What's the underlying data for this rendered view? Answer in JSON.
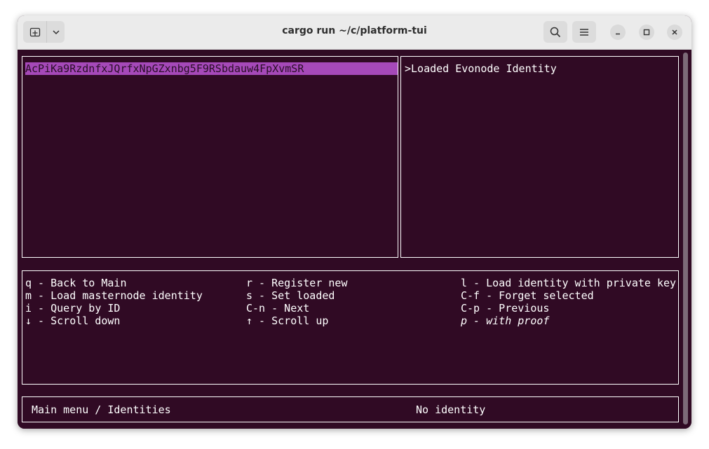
{
  "window": {
    "title": "cargo run ~/c/platform-tui"
  },
  "identities": {
    "items": [
      "AcPiKa9RzdnfxJQrfxNpGZxnbg5F9RSbdauw4FpXvmSR"
    ]
  },
  "detail": {
    "text": ">Loaded Evonode Identity"
  },
  "keybindings": {
    "col1": [
      "q - Back to Main",
      "m - Load masternode identity",
      "i - Query by ID",
      "↓ - Scroll down"
    ],
    "col2": [
      "r - Register new",
      "s - Set loaded",
      "C-n - Next",
      "↑ - Scroll up"
    ],
    "col3": [
      "l - Load identity with private key",
      "C-f - Forget selected",
      "C-p - Previous",
      "p - with proof"
    ]
  },
  "status": {
    "breadcrumb": "Main menu / Identities",
    "identity": "No identity"
  },
  "icons": {
    "new_tab": "new-tab-icon",
    "dropdown": "chevron-down-icon",
    "search": "search-icon",
    "menu": "hamburger-menu-icon",
    "minimize": "minimize-icon",
    "maximize": "maximize-icon",
    "close": "close-icon"
  },
  "colors": {
    "terminal_bg": "#300a24",
    "selection": "#a649b9",
    "foreground": "#ffffff"
  }
}
